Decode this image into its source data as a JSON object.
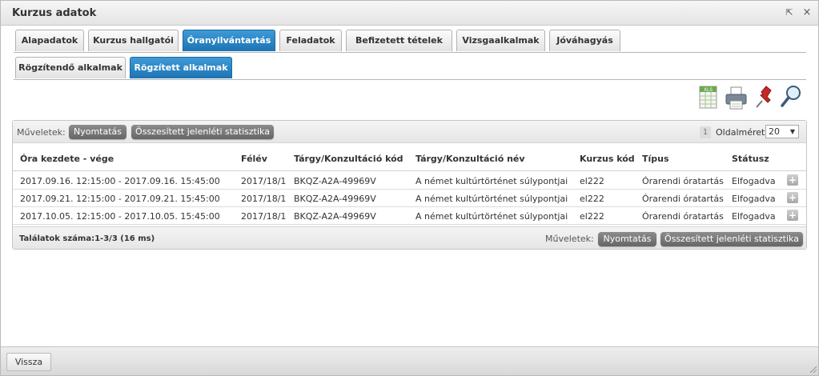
{
  "window": {
    "title": "Kurzus adatok",
    "popout_glyph": "⇱",
    "close_glyph": "×"
  },
  "tabs": [
    {
      "label": "Alapadatok",
      "active": false
    },
    {
      "label": "Kurzus hallgatói",
      "active": false
    },
    {
      "label": "Óranyilvántartás",
      "active": true
    },
    {
      "label": "Feladatok",
      "active": false
    },
    {
      "label": "Befizetett tételek",
      "active": false
    },
    {
      "label": "Vizsgaalkalmak",
      "active": false
    },
    {
      "label": "Jóváhagyás",
      "active": false
    }
  ],
  "subtabs": [
    {
      "label": "Rögzítendő alkalmak",
      "active": false
    },
    {
      "label": "Rögzített alkalmak",
      "active": true
    }
  ],
  "toolbar": {
    "icons": [
      "excel-export-icon",
      "print-icon",
      "pin-icon",
      "search-icon"
    ],
    "xls_text": "XLS"
  },
  "grid": {
    "ops_label": "Műveletek:",
    "print_label": "Nyomtatás",
    "stats_label": "Összesített jelenléti statisztika",
    "page_number": "1",
    "page_size_label": "Oldalméret",
    "page_size_value": "20",
    "columns": [
      "Óra kezdete - vége",
      "Félév",
      "Tárgy/Konzultáció kód",
      "Tárgy/Konzultáció név",
      "Kurzus kód",
      "Típus",
      "Státusz"
    ],
    "rows": [
      [
        "2017.09.16. 12:15:00 - 2017.09.16. 15:45:00",
        "2017/18/1",
        "BKQZ-A2A-49969V",
        "A német kultúrtörténet súlypontjai",
        "el222",
        "Órarendi óratartás",
        "Elfogadva"
      ],
      [
        "2017.09.21. 12:15:00 - 2017.09.21. 15:45:00",
        "2017/18/1",
        "BKQZ-A2A-49969V",
        "A német kultúrtörténet súlypontjai",
        "el222",
        "Órarendi óratartás",
        "Elfogadva"
      ],
      [
        "2017.10.05. 12:15:00 - 2017.10.05. 15:45:00",
        "2017/18/1",
        "BKQZ-A2A-49969V",
        "A német kultúrtörténet súlypontjai",
        "el222",
        "Órarendi óratartás",
        "Elfogadva"
      ]
    ],
    "expand_glyph": "+",
    "results_text": "Találatok száma:1-3/3 (16 ms)"
  },
  "footer": {
    "back_label": "Vissza"
  },
  "colors": {
    "accent": "#1d74b4",
    "button_gray": "#777777"
  }
}
